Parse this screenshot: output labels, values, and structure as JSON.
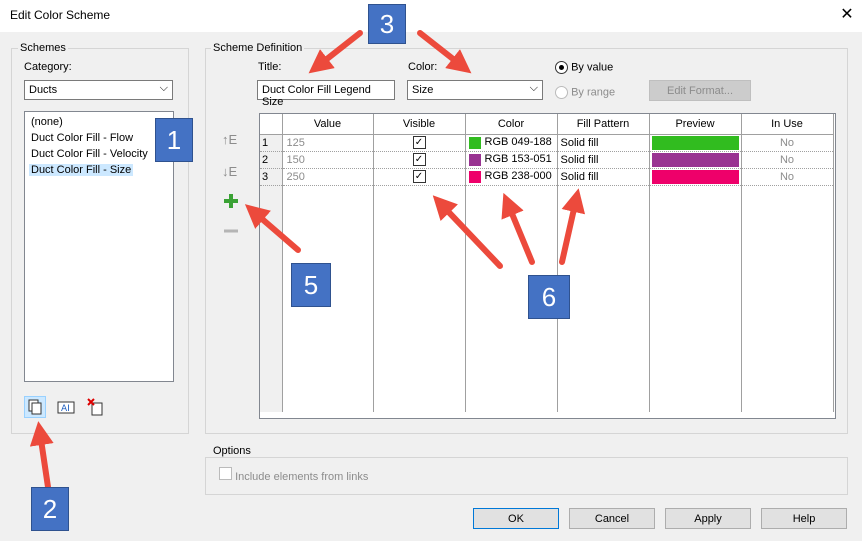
{
  "window": {
    "title": "Edit Color Scheme",
    "close_glyph": "✕"
  },
  "schemes": {
    "group_label": "Schemes",
    "category_label": "Category:",
    "category_value": "Ducts",
    "items": [
      "(none)",
      "Duct Color Fill - Flow",
      "Duct Color Fill - Velocity",
      "Duct Color Fill - Size"
    ],
    "selected_index": 3
  },
  "definition": {
    "group_label": "Scheme Definition",
    "title_label": "Title:",
    "title_value": "Duct Color Fill Legend Size",
    "color_label": "Color:",
    "color_value": "Size",
    "by_value_label": "By value",
    "by_range_label": "By range",
    "edit_format_label": "Edit Format...",
    "columns": [
      "",
      "Value",
      "Visible",
      "Color",
      "Fill Pattern",
      "Preview",
      "In Use"
    ],
    "rows": [
      {
        "num": "1",
        "value": "125",
        "visible": "✓",
        "color_label": "RGB 049-188",
        "color_hex": "#31bc1f",
        "fill": "Solid fill",
        "in_use": "No"
      },
      {
        "num": "2",
        "value": "150",
        "visible": "✓",
        "color_label": "RGB 153-051",
        "color_hex": "#993392",
        "fill": "Solid fill",
        "in_use": "No"
      },
      {
        "num": "3",
        "value": "250",
        "visible": "✓",
        "color_label": "RGB 238-000",
        "color_hex": "#ee006a",
        "fill": "Solid fill",
        "in_use": "No"
      }
    ]
  },
  "options": {
    "group_label": "Options",
    "include_links_label": "Include elements from links"
  },
  "buttons": {
    "ok": "OK",
    "cancel": "Cancel",
    "apply": "Apply",
    "help": "Help"
  },
  "callouts": [
    "1",
    "2",
    "3",
    "5",
    "6"
  ],
  "colors": {
    "callout": "#4472c4",
    "arrow": "#ec4a3c"
  }
}
